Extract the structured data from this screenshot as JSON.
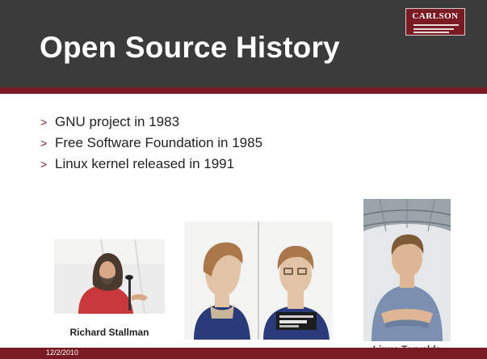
{
  "slide": {
    "title": "Open Source History",
    "logo_text": "CARLSON",
    "bullet_marker": ">",
    "bullets": [
      "GNU project in 1983",
      "Free Software Foundation in 1985",
      "Linux kernel released in 1991"
    ],
    "captions": {
      "stallman": "Richard Stallman",
      "torvalds": "Linus Torvalds"
    },
    "date": "12/2/2010"
  },
  "colors": {
    "header_bg": "#3b3b3b",
    "accent_maroon": "#7a1a22",
    "title_text": "#ffffff",
    "body_text": "#222222"
  }
}
